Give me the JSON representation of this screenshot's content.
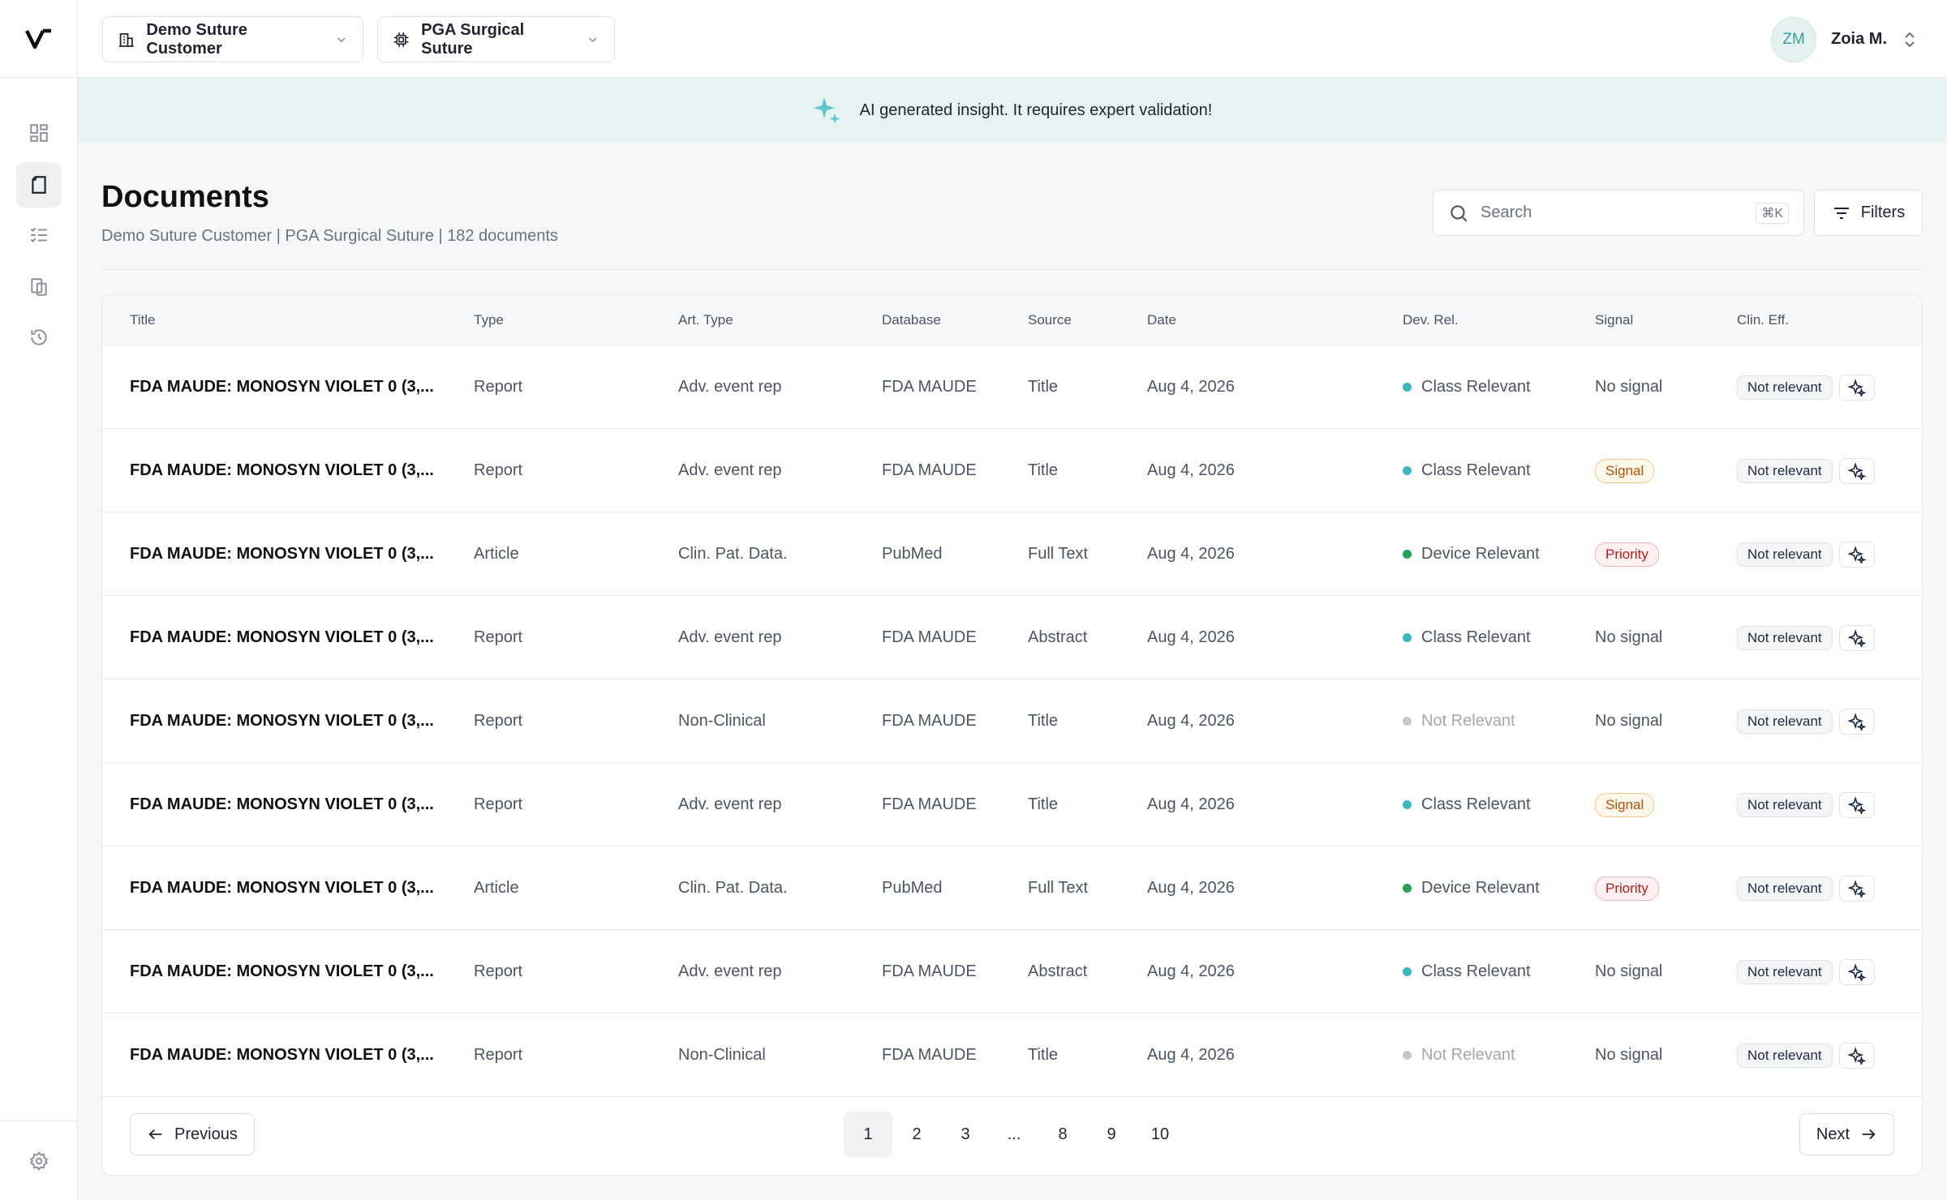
{
  "header": {
    "customer_selector": "Demo Suture Customer",
    "product_selector": "PGA Surgical Suture",
    "user": {
      "initials": "ZM",
      "name": "Zoia M."
    }
  },
  "banner": {
    "text": "AI generated insight. It requires expert validation!"
  },
  "page": {
    "title": "Documents",
    "subtitle": "Demo Suture Customer | PGA Surgical Suture | 182 documents"
  },
  "search": {
    "placeholder": "Search",
    "shortcut": "⌘K"
  },
  "filters_label": "Filters",
  "table": {
    "columns": [
      "Title",
      "Type",
      "Art. Type",
      "Database",
      "Source",
      "Date",
      "Dev. Rel.",
      "Signal",
      "Clin. Eff."
    ],
    "rows": [
      {
        "title": "FDA MAUDE: MONOSYN VIOLET 0 (3,...",
        "type": "Report",
        "art_type": "Adv. event rep",
        "database": "FDA MAUDE",
        "source": "Title",
        "date": "Aug 4, 2026",
        "dev_rel": "Class Relevant",
        "signal": "No signal",
        "clin_eff": "Not relevant"
      },
      {
        "title": "FDA MAUDE: MONOSYN VIOLET 0 (3,...",
        "type": "Report",
        "art_type": "Adv. event rep",
        "database": "FDA MAUDE",
        "source": "Title",
        "date": "Aug 4, 2026",
        "dev_rel": "Class Relevant",
        "signal": "Signal",
        "clin_eff": "Not relevant"
      },
      {
        "title": "FDA MAUDE: MONOSYN VIOLET 0 (3,...",
        "type": "Article",
        "art_type": "Clin. Pat. Data.",
        "database": "PubMed",
        "source": "Full Text",
        "date": "Aug 4, 2026",
        "dev_rel": "Device Relevant",
        "signal": "Priority",
        "clin_eff": "Not relevant"
      },
      {
        "title": "FDA MAUDE: MONOSYN VIOLET 0 (3,...",
        "type": "Report",
        "art_type": "Adv. event rep",
        "database": "FDA MAUDE",
        "source": "Abstract",
        "date": "Aug 4, 2026",
        "dev_rel": "Class Relevant",
        "signal": "No signal",
        "clin_eff": "Not relevant"
      },
      {
        "title": "FDA MAUDE: MONOSYN VIOLET 0 (3,...",
        "type": "Report",
        "art_type": "Non-Clinical",
        "database": "FDA MAUDE",
        "source": "Title",
        "date": "Aug 4, 2026",
        "dev_rel": "Not Relevant",
        "signal": "No signal",
        "clin_eff": "Not relevant"
      },
      {
        "title": "FDA MAUDE: MONOSYN VIOLET 0 (3,...",
        "type": "Report",
        "art_type": "Adv. event rep",
        "database": "FDA MAUDE",
        "source": "Title",
        "date": "Aug 4, 2026",
        "dev_rel": "Class Relevant",
        "signal": "Signal",
        "clin_eff": "Not relevant"
      },
      {
        "title": "FDA MAUDE: MONOSYN VIOLET 0 (3,...",
        "type": "Article",
        "art_type": "Clin. Pat. Data.",
        "database": "PubMed",
        "source": "Full Text",
        "date": "Aug 4, 2026",
        "dev_rel": "Device Relevant",
        "signal": "Priority",
        "clin_eff": "Not relevant"
      },
      {
        "title": "FDA MAUDE: MONOSYN VIOLET 0 (3,...",
        "type": "Report",
        "art_type": "Adv. event rep",
        "database": "FDA MAUDE",
        "source": "Abstract",
        "date": "Aug 4, 2026",
        "dev_rel": "Class Relevant",
        "signal": "No signal",
        "clin_eff": "Not relevant"
      },
      {
        "title": "FDA MAUDE: MONOSYN VIOLET 0 (3,...",
        "type": "Report",
        "art_type": "Non-Clinical",
        "database": "FDA MAUDE",
        "source": "Title",
        "date": "Aug 4, 2026",
        "dev_rel": "Not Relevant",
        "signal": "No signal",
        "clin_eff": "Not relevant"
      }
    ]
  },
  "status_colors": {
    "Class Relevant": "#3bb7c4",
    "Device Relevant": "#22a35a",
    "Not Relevant": "#c4c7cc"
  },
  "pagination": {
    "previous": "Previous",
    "next": "Next",
    "pages": [
      "1",
      "2",
      "3",
      "...",
      "8",
      "9",
      "10"
    ],
    "current": "1"
  }
}
